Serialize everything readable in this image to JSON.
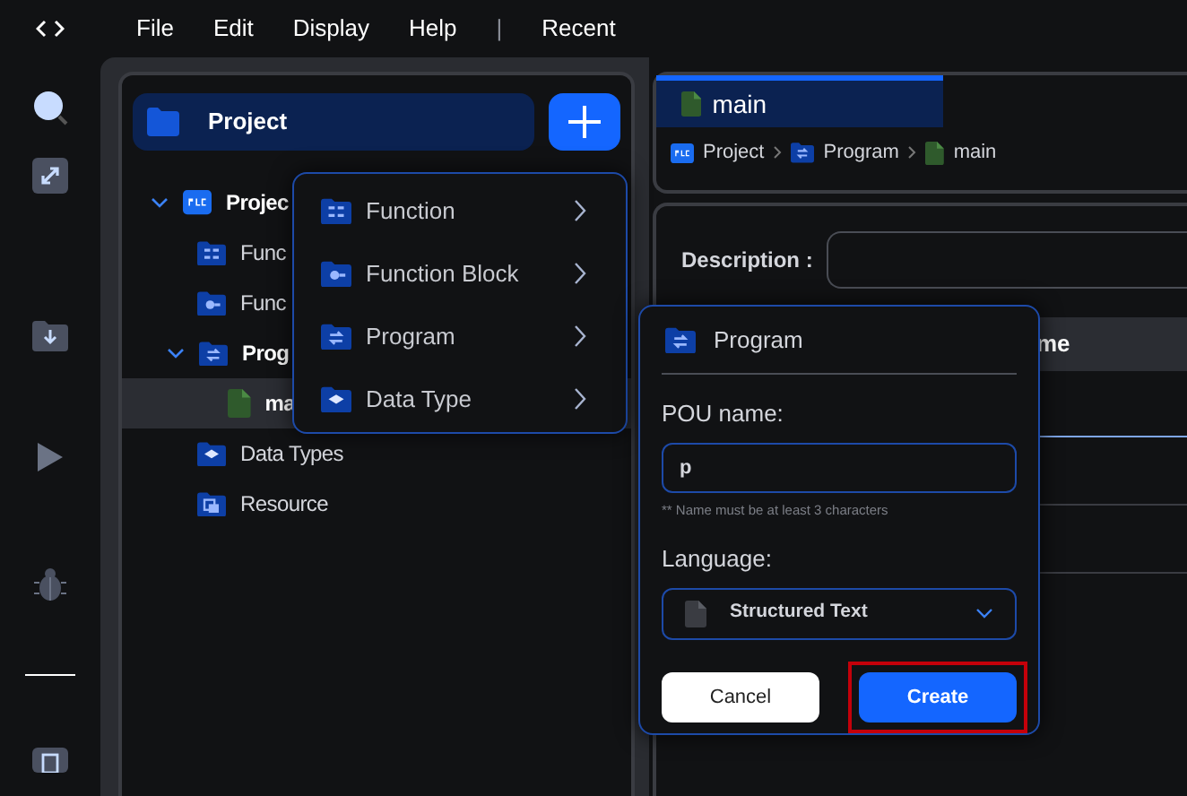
{
  "menu_bar": {
    "items": [
      "File",
      "Edit",
      "Display",
      "Help"
    ],
    "separator": "|",
    "recent": "Recent"
  },
  "project_header": {
    "title": "Project"
  },
  "tree": [
    {
      "label": "Projec",
      "kind": "plc",
      "expanded": true,
      "selected": false,
      "children": [
        {
          "label": "Func",
          "kind": "function",
          "selected": false
        },
        {
          "label": "Func",
          "kind": "function-block",
          "selected": false
        },
        {
          "label": "Prog",
          "kind": "program",
          "expanded": true,
          "selected": false,
          "children": [
            {
              "label": "ma",
              "kind": "file",
              "selected": true
            }
          ]
        },
        {
          "label": "Data Types",
          "kind": "datatype",
          "selected": false
        },
        {
          "label": "Resource",
          "kind": "resource",
          "selected": false
        }
      ]
    }
  ],
  "add_menu": [
    {
      "label": "Function",
      "kind": "function"
    },
    {
      "label": "Function Block",
      "kind": "function-block"
    },
    {
      "label": "Program",
      "kind": "program"
    },
    {
      "label": "Data Type",
      "kind": "datatype"
    }
  ],
  "editor_tab": {
    "label": "main",
    "selected": true
  },
  "breadcrumb": [
    {
      "label": "Project",
      "kind": "plc"
    },
    {
      "label": "Program",
      "kind": "program"
    },
    {
      "label": "main",
      "kind": "file"
    }
  ],
  "description": {
    "label": "Description :"
  },
  "table": {
    "columns": [
      "me"
    ]
  },
  "dialog": {
    "title": "Program",
    "name_label": "POU name:",
    "name_value": "p",
    "hint": "** Name must be at least 3 characters",
    "language_label": "Language:",
    "language_value": "Structured Text",
    "cancel": "Cancel",
    "create": "Create",
    "create_highlighted": true
  }
}
